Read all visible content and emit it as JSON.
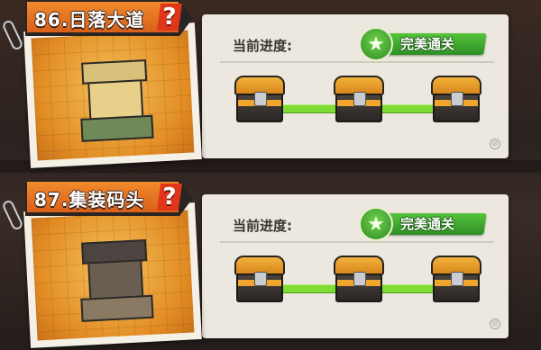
{
  "levels": [
    {
      "title": "86.日落大道",
      "help_icon": "?",
      "progress_label": "当前进度:",
      "status_badge": "完美通关",
      "status_color": "#3fa62b",
      "chests": 3,
      "thumbnail_icon": "temple-building-icon"
    },
    {
      "title": "87.集装码头",
      "help_icon": "?",
      "progress_label": "当前进度:",
      "status_badge": "完美通关",
      "status_color": "#3fa62b",
      "chests": 3,
      "thumbnail_icon": "dock-building-icon"
    }
  ],
  "colors": {
    "title_tag": "#e8741f",
    "progress_track": "#7edc33",
    "chest_gold": "#f0a52c"
  }
}
